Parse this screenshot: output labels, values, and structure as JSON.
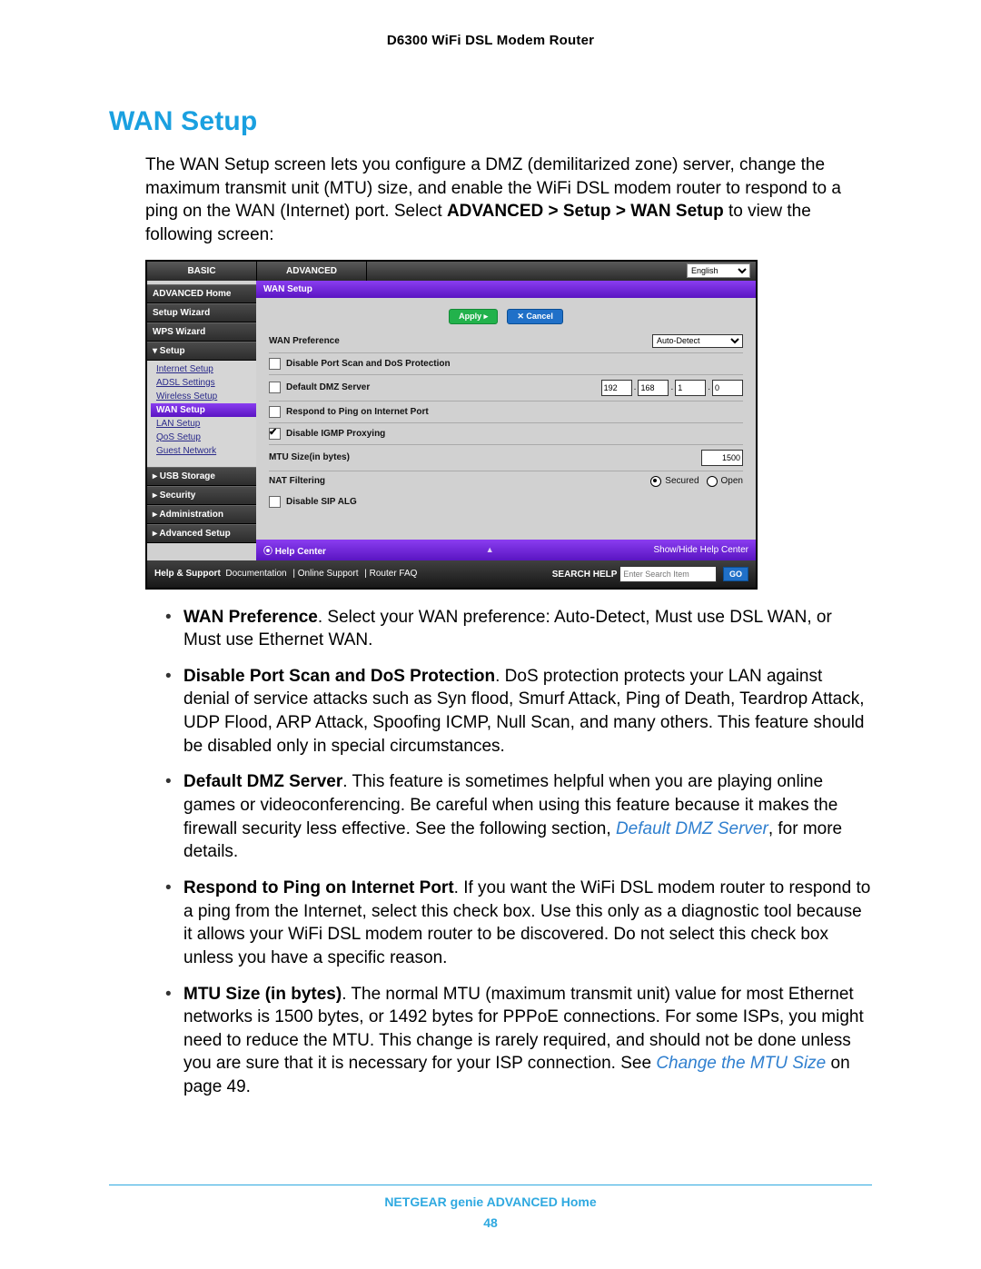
{
  "doc_header": "D6300 WiFi DSL Modem Router",
  "section_title": "WAN Setup",
  "intro_parts": {
    "p1": "The WAN Setup screen lets you configure a DMZ (demilitarized zone) server, change the maximum transmit unit (MTU) size, and enable the WiFi DSL modem router to respond to a ping on the WAN (Internet) port. Select ",
    "p1_bold": "ADVANCED > Setup > WAN Setup",
    "p1_tail": " to view the following screen:"
  },
  "router": {
    "tabs": {
      "basic": "BASIC",
      "advanced": "ADVANCED",
      "language": "English"
    },
    "side": {
      "items": [
        {
          "label": "ADVANCED Home",
          "sel": false
        },
        {
          "label": "Setup Wizard",
          "sel": false
        },
        {
          "label": "WPS Wizard",
          "sel": false
        }
      ],
      "setup_label": "▾ Setup",
      "setup_children": [
        {
          "label": "Internet Setup",
          "sel": false
        },
        {
          "label": "ADSL Settings",
          "sel": false
        },
        {
          "label": "Wireless Setup",
          "sel": false
        },
        {
          "label": "WAN Setup",
          "sel": true
        },
        {
          "label": "LAN Setup",
          "sel": false
        },
        {
          "label": "QoS Setup",
          "sel": false
        },
        {
          "label": "Guest Network",
          "sel": false
        }
      ],
      "rest": [
        "▸ USB Storage",
        "▸ Security",
        "▸ Administration",
        "▸ Advanced Setup"
      ]
    },
    "main": {
      "title": "WAN Setup",
      "apply": "Apply ▸",
      "cancel": "✕ Cancel",
      "rows": {
        "wan_pref": {
          "label": "WAN Preference",
          "value": "Auto-Detect"
        },
        "disable_port": {
          "label": "Disable Port Scan and DoS Protection",
          "checked": false
        },
        "default_dmz": {
          "label": "Default DMZ Server",
          "checked": false,
          "ip": [
            "192",
            "168",
            "1",
            "0"
          ]
        },
        "ping": {
          "label": "Respond to Ping on Internet Port",
          "checked": false
        },
        "igmp": {
          "label": "Disable IGMP Proxying",
          "checked": true
        },
        "mtu": {
          "label": "MTU Size(in bytes)",
          "value": "1500"
        },
        "nat": {
          "label": "NAT Filtering",
          "secured": "Secured",
          "open": "Open",
          "sel": "secured"
        },
        "sip": {
          "label": "Disable SIP ALG",
          "checked": false
        }
      }
    },
    "helpbar": {
      "left": "⦿ Help Center",
      "right": "Show/Hide Help Center"
    },
    "support": {
      "left_label": "Help & Support",
      "links": [
        "Documentation",
        "Online Support",
        "Router FAQ"
      ],
      "search_label": "SEARCH HELP",
      "placeholder": "Enter Search Item",
      "go": "GO"
    }
  },
  "bullets": [
    {
      "name": "WAN Preference",
      "text": ". Select your WAN preference: Auto-Detect, Must use DSL WAN, or Must use Ethernet WAN."
    },
    {
      "name": "Disable Port Scan and DoS Protection",
      "text": ". DoS protection protects your LAN against denial of service attacks such as Syn flood, Smurf Attack, Ping of Death, Teardrop Attack, UDP Flood, ARP Attack, Spoofing ICMP, Null Scan, and many others. This feature should be disabled only in special circumstances."
    },
    {
      "name": "Default DMZ Server",
      "text": ". This feature is sometimes helpful when you are playing online games or videoconferencing. Be careful when using this feature because it makes the firewall security less effective. See the following section, ",
      "link": "Default DMZ Server",
      "tail": ", for more details."
    },
    {
      "name": "Respond to Ping on Internet Port",
      "text": ". If you want the WiFi DSL modem router to respond to a ping from the Internet, select this check box. Use this only as a diagnostic tool because it allows your WiFi DSL modem router to be discovered. Do not select this check box unless you have a specific reason."
    },
    {
      "name": "MTU Size (in bytes)",
      "text": ". The normal MTU (maximum transmit unit) value for most Ethernet networks is 1500 bytes, or 1492 bytes for PPPoE connections. For some ISPs, you might need to reduce the MTU. This change is rarely required, and should not be done unless you are sure that it is necessary for your ISP connection. See ",
      "link": "Change the MTU Size",
      "tail": " on page 49."
    }
  ],
  "footer": {
    "line1": "NETGEAR genie ADVANCED Home",
    "page": "48"
  }
}
